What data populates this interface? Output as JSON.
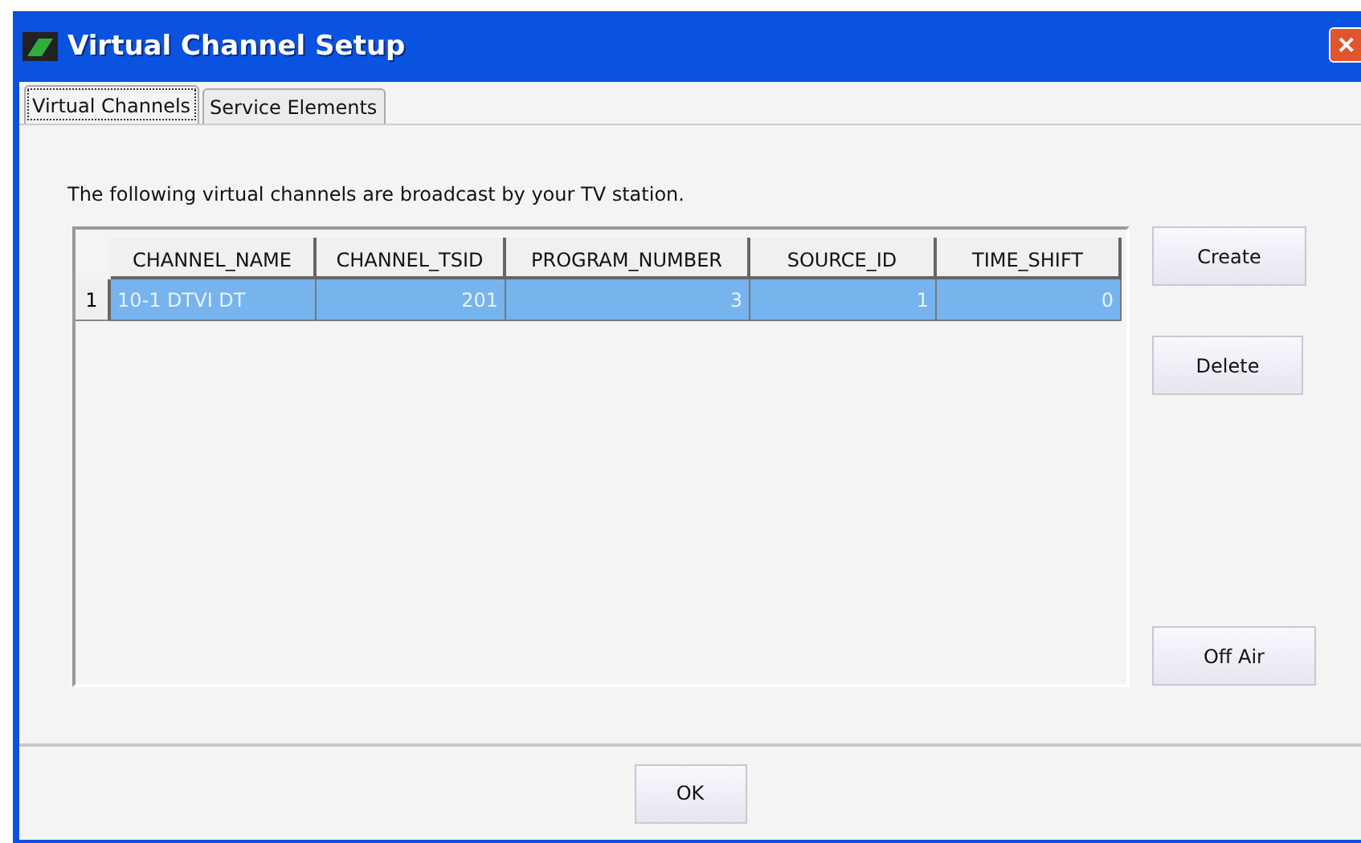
{
  "window": {
    "title": "Virtual Channel Setup",
    "close_glyph": "✕"
  },
  "tabs": [
    {
      "label": "Virtual Channels",
      "selected": true
    },
    {
      "label": "Service Elements",
      "selected": false
    }
  ],
  "description": "The following virtual channels are broadcast by your TV station.",
  "table": {
    "columns": [
      "CHANNEL_NAME",
      "CHANNEL_TSID",
      "PROGRAM_NUMBER",
      "SOURCE_ID",
      "TIME_SHIFT"
    ],
    "rows": [
      {
        "number": "1",
        "selected": true,
        "cells": [
          "10-1 DTVI DT",
          "201",
          "3",
          "1",
          "0"
        ]
      }
    ]
  },
  "side_buttons": [
    "Create",
    "Delete",
    "Off Air"
  ],
  "ok_button": "OK"
}
